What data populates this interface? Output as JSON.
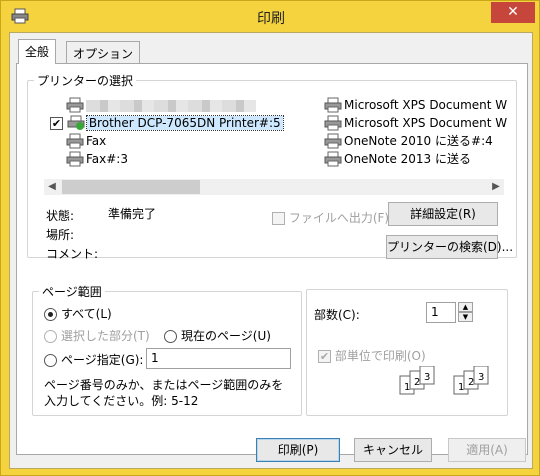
{
  "window": {
    "title": "印刷",
    "close_glyph": "✕"
  },
  "tabs": [
    {
      "label": "全般",
      "active": true
    },
    {
      "label": "オプション",
      "active": false
    }
  ],
  "printer_select": {
    "legend": "プリンターの選択",
    "printers": [
      {
        "label": "",
        "blurred": true
      },
      {
        "label": "Brother DCP-7065DN Printer#:5",
        "selected": true,
        "default": true
      },
      {
        "label": "Fax"
      },
      {
        "label": "Fax#:3"
      },
      {
        "label": "Microsoft XPS Document W"
      },
      {
        "label": "Microsoft XPS Document W"
      },
      {
        "label": "OneNote 2010 に送る#:4"
      },
      {
        "label": "OneNote 2013 に送る"
      }
    ],
    "status_label": "状態:",
    "status_value": "準備完了",
    "location_label": "場所:",
    "comment_label": "コメント:",
    "print_to_file_label": "ファイルへ出力(F)",
    "preferences_button": "詳細設定(R)",
    "find_printer_button": "プリンターの検索(D)..."
  },
  "page_range": {
    "legend": "ページ範囲",
    "all_label": "すべて(L)",
    "selection_label": "選択した部分(T)",
    "current_page_label": "現在のページ(U)",
    "pages_label": "ページ指定(G):",
    "pages_value": "1",
    "hint": "ページ番号のみか、またはページ範囲のみを入力してください。例: 5-12",
    "selected_option": "all"
  },
  "copies": {
    "label": "部数(C):",
    "value": "1",
    "collate_label": "部単位で印刷(O)",
    "collate_checked": true,
    "collate_disabled": true
  },
  "footer": {
    "print_button": "印刷(P)",
    "cancel_button": "キャンセル",
    "apply_button": "適用(A)"
  },
  "colors": {
    "titlebar": "#f5d33e",
    "close": "#c7463b",
    "default_button_border": "#3c7fb1"
  }
}
